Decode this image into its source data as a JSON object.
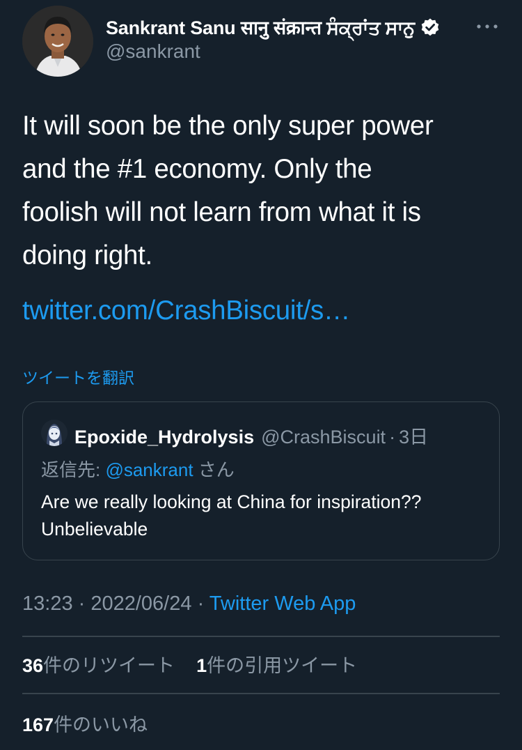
{
  "author": {
    "display_name": "Sankrant Sanu सानु संक्रान्त ਸੰਕ੍ਰਾਂਤ ਸਾਨੁ",
    "handle": "@sankrant",
    "verified": true,
    "avatar_icon": "profile-photo"
  },
  "more_icon": "more-horizontal-icon",
  "tweet": {
    "text_lines": [
      "It will soon be the only super power",
      "and the #1 economy. Only the",
      "foolish will not learn from what it is",
      "doing right."
    ],
    "link": "twitter.com/CrashBiscuit/s…",
    "translate_label": "ツイートを翻訳"
  },
  "quoted": {
    "display_name": "Epoxide_Hydrolysis",
    "handle": "@CrashBiscuit",
    "separator": "·",
    "time": "3日",
    "reply_prefix": "返信先: ",
    "reply_mention": "@sankrant",
    "reply_suffix": " さん",
    "text_lines": [
      "Are we really looking at China for inspiration??",
      "Unbelievable"
    ]
  },
  "meta": {
    "time": "13:23",
    "separator1": " · ",
    "date": "2022/06/24",
    "separator2": " · ",
    "source": "Twitter Web App"
  },
  "stats": {
    "retweet_count": "36",
    "retweet_label": "件のリツイート",
    "quote_count": "1",
    "quote_label": "件の引用ツイート",
    "like_count": "167",
    "like_label": "件のいいね"
  },
  "colors": {
    "background": "#15202b",
    "accent": "#1d9bf0",
    "secondary_text": "#8b98a5",
    "border": "#38444d"
  }
}
